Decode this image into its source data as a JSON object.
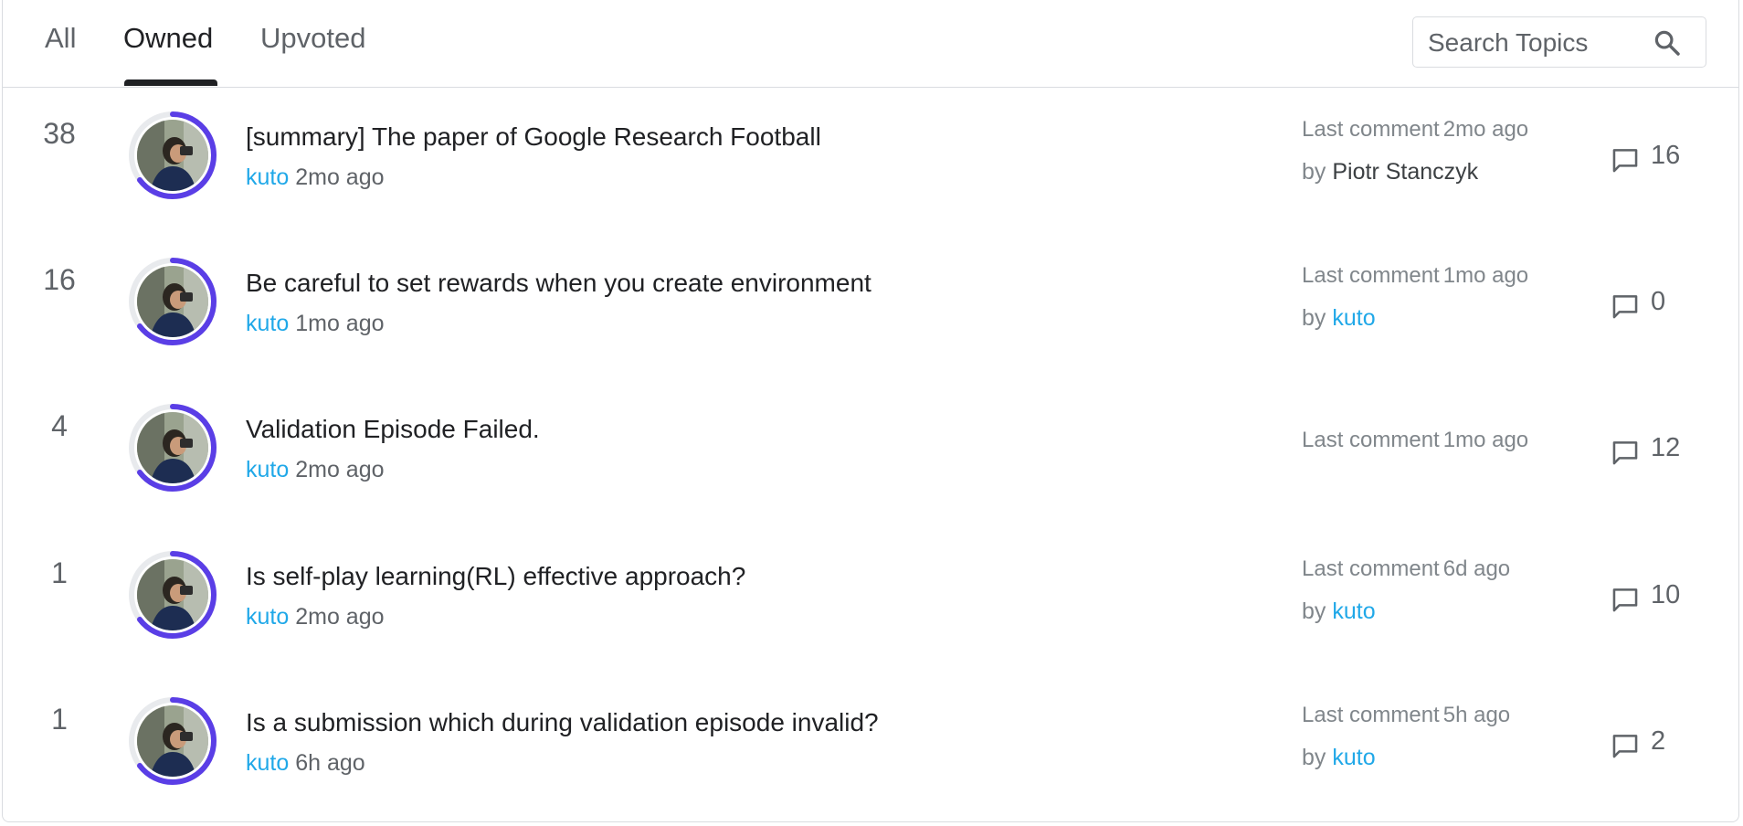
{
  "tabs": [
    {
      "label": "All",
      "active": false
    },
    {
      "label": "Owned",
      "active": true
    },
    {
      "label": "Upvoted",
      "active": false
    }
  ],
  "search": {
    "placeholder": "Search Topics",
    "value": "",
    "icon": "search-icon"
  },
  "colors": {
    "accent_ring": "#5a3ee6",
    "link": "#20a8e8"
  },
  "topics": [
    {
      "votes": "38",
      "title": "[summary] The paper of Google Research Football",
      "author": "kuto",
      "posted": "2mo ago",
      "last_comment_label": "Last comment",
      "last_comment_time": "2mo ago",
      "by_label": "by",
      "last_commenter": "Piotr Stanczyk",
      "comment_count": "16"
    },
    {
      "votes": "16",
      "title": "Be careful to set rewards when you create environment",
      "author": "kuto",
      "posted": "1mo ago",
      "last_comment_label": "Last comment",
      "last_comment_time": "1mo ago",
      "by_label": "by",
      "last_commenter": "kuto",
      "comment_count": "0"
    },
    {
      "votes": "4",
      "title": "Validation Episode Failed.",
      "author": "kuto",
      "posted": "2mo ago",
      "last_comment_label": "Last comment",
      "last_comment_time": "1mo ago",
      "by_label": "",
      "last_commenter": "",
      "comment_count": "12"
    },
    {
      "votes": "1",
      "title": "Is self-play learning(RL) effective approach?",
      "author": "kuto",
      "posted": "2mo ago",
      "last_comment_label": "Last comment",
      "last_comment_time": "6d ago",
      "by_label": "by",
      "last_commenter": "kuto",
      "comment_count": "10"
    },
    {
      "votes": "1",
      "title": "Is a submission which during validation episode invalid?",
      "author": "kuto",
      "posted": "6h ago",
      "last_comment_label": "Last comment",
      "last_comment_time": "5h ago",
      "by_label": "by",
      "last_commenter": "kuto",
      "comment_count": "2"
    }
  ]
}
